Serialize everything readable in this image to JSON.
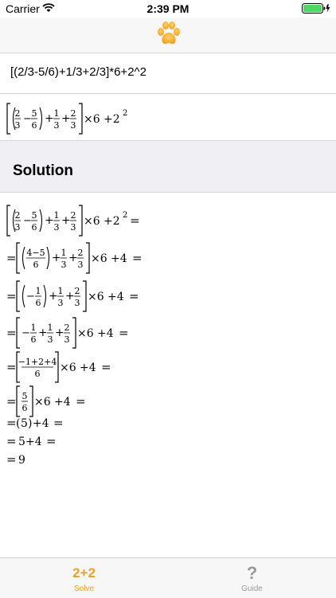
{
  "status_bar": {
    "carrier": "Carrier",
    "time": "2:39 PM"
  },
  "header": {
    "logo_icon": "paw-icon",
    "accent": "#f5a623"
  },
  "input": {
    "expression": "[(2/3-5/6)+1/3+2/3]*6+2^2"
  },
  "solution": {
    "title": "Solution"
  },
  "tabs": [
    {
      "icon": "2+2",
      "label": "Solve",
      "active": true
    },
    {
      "icon": "?",
      "label": "Guide",
      "active": false
    }
  ],
  "math": {
    "one": "1",
    "two": "2",
    "three": "3",
    "four": "4",
    "five": "5",
    "six": "6",
    "nine": "9",
    "times6": "×6",
    "plus2": "+2",
    "plus4": "+4",
    "plus": "+",
    "minus": "−",
    "eq": "=",
    "lpar": "(",
    "rpar": ")",
    "lbr": "[",
    "rbr": "]",
    "four_minus_five": "4−5",
    "m1p2p4": "−1+2+4",
    "neg": "−",
    "neg1": "−1"
  }
}
